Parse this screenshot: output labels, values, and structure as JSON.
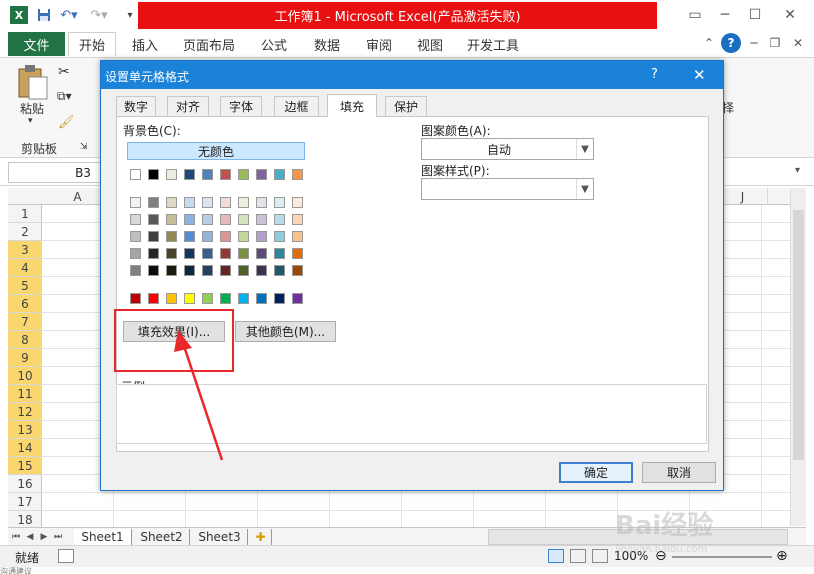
{
  "window": {
    "title": "工作簿1 - Microsoft Excel(产品激活失败)"
  },
  "ribbon_tabs": [
    "文件",
    "开始",
    "插入",
    "页面布局",
    "公式",
    "数据",
    "审阅",
    "视图",
    "开发工具"
  ],
  "ribbon": {
    "paste_label": "粘贴",
    "clipboard_group": "剪贴板",
    "partial_label": "择"
  },
  "formula_bar": {
    "name_box": "B3"
  },
  "grid": {
    "columns": [
      "A",
      "J"
    ],
    "rows": [
      "1",
      "2",
      "3",
      "4",
      "5",
      "6",
      "7",
      "8",
      "9",
      "10",
      "11",
      "12",
      "13",
      "14",
      "15",
      "16",
      "17",
      "18"
    ],
    "selected_rows": [
      3,
      4,
      5,
      6,
      7,
      8,
      9,
      10,
      11,
      12,
      13,
      14,
      15
    ]
  },
  "sheets": [
    "Sheet1",
    "Sheet2",
    "Sheet3"
  ],
  "status": {
    "ready": "就绪",
    "zoom": "100%",
    "bottom_left_fragment": "沟通建议"
  },
  "dialog": {
    "title": "设置单元格格式",
    "help_label": "?",
    "tabs": [
      "数字",
      "对齐",
      "字体",
      "边框",
      "填充",
      "保护"
    ],
    "active_tab": "填充",
    "background_color_label": "背景色(C):",
    "no_color_label": "无颜色",
    "fill_effects_button": "填充效果(I)...",
    "more_colors_button": "其他颜色(M)...",
    "pattern_color_label": "图案颜色(A):",
    "pattern_color_value": "自动",
    "pattern_style_label": "图案样式(P):",
    "pattern_style_value": "",
    "sample_label": "示例",
    "ok_button": "确定",
    "cancel_button": "取消",
    "colors": {
      "row_top": [
        "#ffffff",
        "#000000",
        "#eeece1",
        "#1f497d",
        "#4f81bd",
        "#c0504d",
        "#9bbb59",
        "#8064a2",
        "#4bacc6",
        "#f79646"
      ],
      "tints": [
        [
          "#f2f2f2",
          "#7f7f7f",
          "#ddd9c3",
          "#c6d9f0",
          "#dbe5f1",
          "#f2dcdb",
          "#ebf1dd",
          "#e5e0ec",
          "#dbeef3",
          "#fdeada"
        ],
        [
          "#d8d8d8",
          "#595959",
          "#c4bd97",
          "#8db3e2",
          "#b8cce4",
          "#e5b9b7",
          "#d7e3bc",
          "#ccc1d9",
          "#b7dde8",
          "#fbd5b5"
        ],
        [
          "#bfbfbf",
          "#3f3f3f",
          "#938953",
          "#548dd4",
          "#95b3d7",
          "#d99694",
          "#c3d69b",
          "#b2a2c7",
          "#92cddc",
          "#fac08f"
        ],
        [
          "#a5a5a5",
          "#262626",
          "#494429",
          "#17365d",
          "#366092",
          "#953734",
          "#76923c",
          "#5f497a",
          "#31859b",
          "#e36c09"
        ],
        [
          "#7f7f7f",
          "#0c0c0c",
          "#1d1b10",
          "#0f243e",
          "#244061",
          "#632423",
          "#4f6128",
          "#3f3151",
          "#205867",
          "#974806"
        ]
      ],
      "standard": [
        "#c00000",
        "#ff0000",
        "#ffc000",
        "#ffff00",
        "#92d050",
        "#00b050",
        "#00b0f0",
        "#0070c0",
        "#002060",
        "#7030a0"
      ]
    }
  },
  "accent_colors": {
    "excel_green": "#217346",
    "title_red": "#e81010",
    "dialog_blue": "#1a82d8",
    "annotation_red": "#e8282b",
    "row_highlight": "#f9d66e"
  },
  "watermark": {
    "text": "Bai经验",
    "subtext": "jingyan.baidu.com"
  }
}
